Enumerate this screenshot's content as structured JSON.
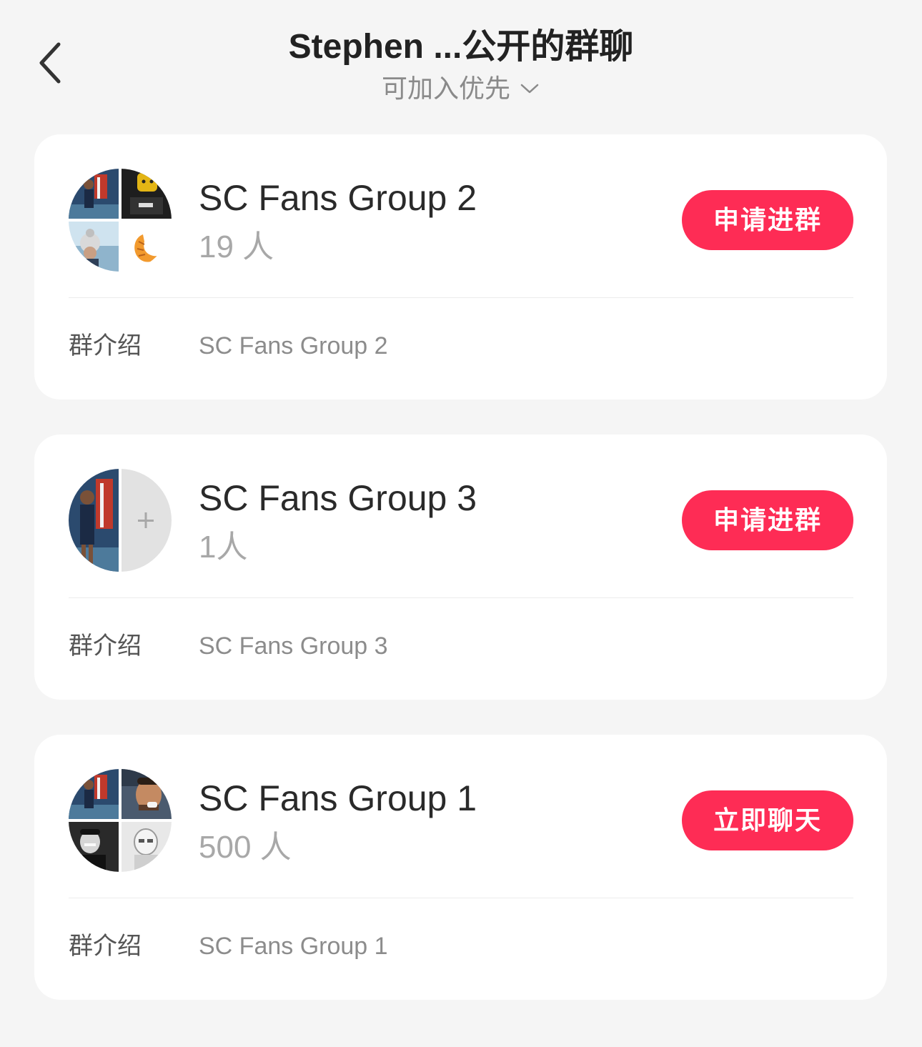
{
  "header": {
    "title": "Stephen ...公开的群聊",
    "sort_label": "可加入优先",
    "back_icon": "chevron-left-icon",
    "sort_icon": "chevron-down-icon"
  },
  "colors": {
    "accent": "#fe2c55",
    "background": "#f5f5f5",
    "card": "#ffffff"
  },
  "groups": [
    {
      "name": "SC Fans Group 2",
      "members": "19 人",
      "action": "申请进群",
      "intro_label": "群介绍",
      "intro": "SC Fans Group 2"
    },
    {
      "name": "SC Fans Group 3",
      "members": "1人",
      "action": "申请进群",
      "intro_label": "群介绍",
      "intro": "SC Fans Group 3"
    },
    {
      "name": "SC Fans Group 1",
      "members": "500 人",
      "action": "立即聊天",
      "intro_label": "群介绍",
      "intro": "SC Fans Group 1"
    }
  ]
}
